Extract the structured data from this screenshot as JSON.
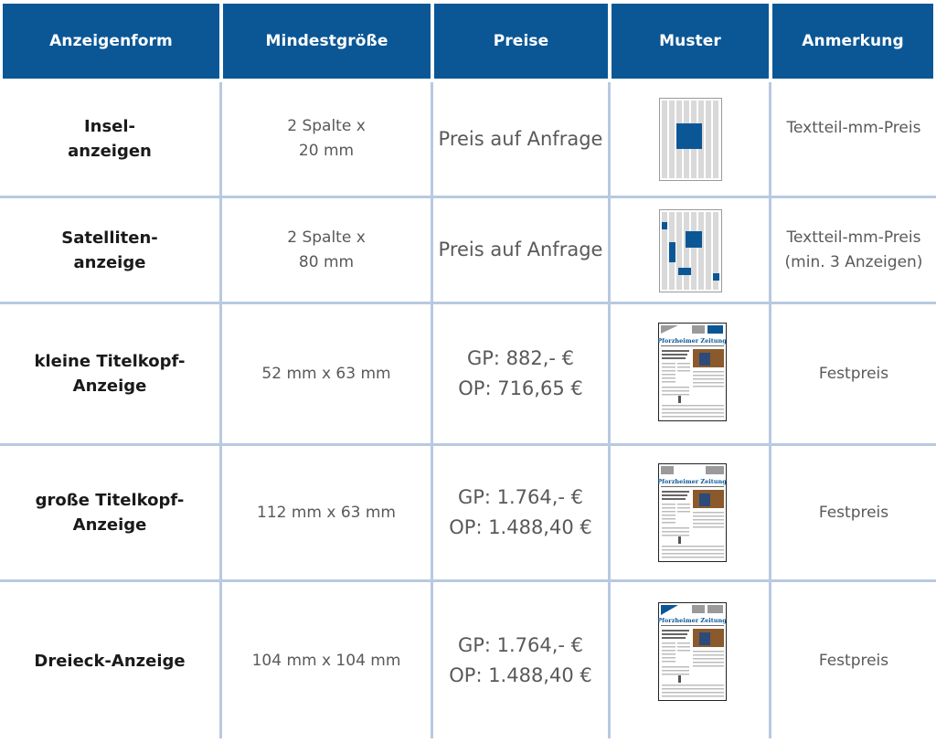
{
  "header": {
    "col1": "Anzeigenform",
    "col2": "Mindestgröße",
    "col3": "Preise",
    "col4": "Muster",
    "col5": "Anmerkung"
  },
  "rows": [
    {
      "form": "Insel-\nanzeigen",
      "size": "2 Spalte x\n20 mm",
      "price": "Preis auf Anfrage",
      "sample": "insel-ad-diagram",
      "note": "Textteil-mm-Preis"
    },
    {
      "form": "Satelliten-\nanzeige",
      "size": "2 Spalte x\n80 mm",
      "price": "Preis auf Anfrage",
      "sample": "satellite-ad-diagram",
      "note": "Textteil-mm-Preis\n(min. 3 Anzeigen)"
    },
    {
      "form": "kleine Titelkopf-\nAnzeige",
      "size": "52 mm x 63 mm",
      "price": "GP: 882,- €\nOP: 716,65 €",
      "sample": "newspaper-small-header-ad",
      "note": "Festpreis"
    },
    {
      "form": "große Titelkopf-\nAnzeige",
      "size": "112 mm x 63 mm",
      "price": "GP: 1.764,- €\nOP: 1.488,40 €",
      "sample": "newspaper-large-header-ad",
      "note": "Festpreis"
    },
    {
      "form": "Dreieck-Anzeige",
      "size": "104 mm x 104 mm",
      "price": "GP: 1.764,- €\nOP: 1.488,40 €",
      "sample": "newspaper-triangle-ad",
      "note": "Festpreis"
    }
  ],
  "newspaper_name": "Pforzheimer Zeitung",
  "colors": {
    "header_bg": "#0b5796",
    "accent_blue": "#0b5796",
    "grid_line": "#b8c9e1",
    "column_gray": "#d9d9d9"
  }
}
